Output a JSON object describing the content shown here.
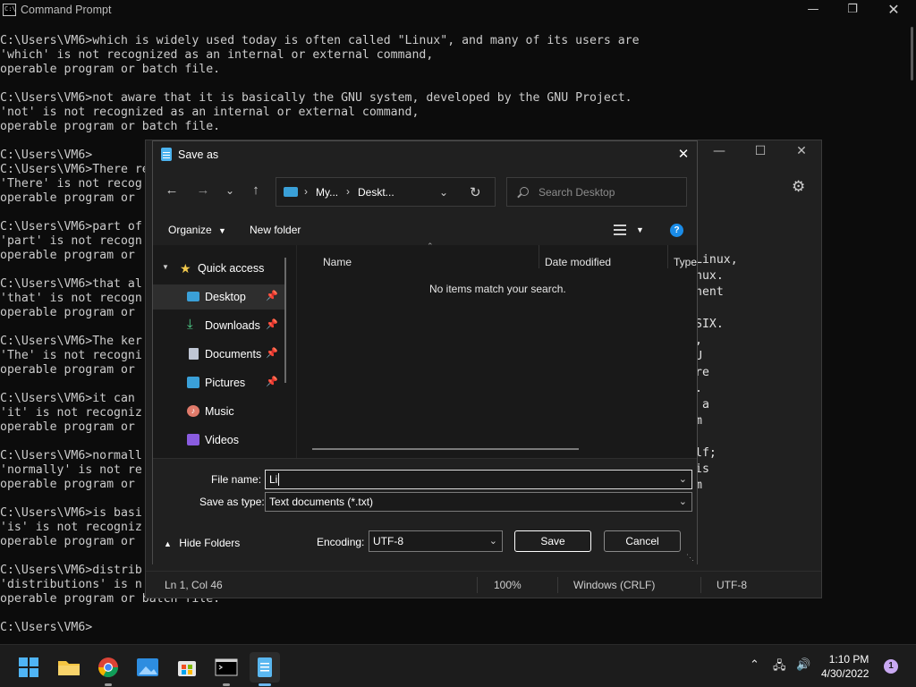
{
  "cmd": {
    "title": "Command Prompt",
    "lines": "C:\\Users\\VM6>which is widely used today is often called \"Linux\", and many of its users are\n'which' is not recognized as an internal or external command,\noperable program or batch file.\n\nC:\\Users\\VM6>not aware that it is basically the GNU system, developed by the GNU Project.\n'not' is not recognized as an internal or external command,\noperable program or batch file.\n\nC:\\Users\\VM6>\nC:\\Users\\VM6>There re\n'There' is not recog\noperable program or \n\nC:\\Users\\VM6>part of\n'part' is not recogn\noperable program or \n\nC:\\Users\\VM6>that al\n'that' is not recogn\noperable program or \n\nC:\\Users\\VM6>The ker\n'The' is not recogni\noperable program or \n\nC:\\Users\\VM6>it can \n'it' is not recogniz\noperable program or \n\nC:\\Users\\VM6>normall\n'normally' is not re\noperable program or \n\nC:\\Users\\VM6>is basi\n'is' is not recogniz\noperable program or \n\nC:\\Users\\VM6>distrib\n'distributions' is n\noperable program or batch file.\n\nC:\\Users\\VM6>"
  },
  "notepad": {
    "visible_text": "Linux,\nnux.\nnent\n\nSIX.\n,\nU\nre\n.\n a\nm\n\nlf;\nis\nm",
    "status": {
      "position": "Ln 1, Col 46",
      "zoom": "100%",
      "line_ending": "Windows (CRLF)",
      "encoding": "UTF-8"
    }
  },
  "dialog": {
    "title": "Save as",
    "address": {
      "part1": "My...",
      "part2": "Deskt..."
    },
    "search_placeholder": "Search Desktop",
    "toolbar": {
      "organize": "Organize",
      "new_folder": "New folder"
    },
    "nav_items": [
      {
        "label": "Quick access"
      },
      {
        "label": "Desktop"
      },
      {
        "label": "Downloads"
      },
      {
        "label": "Documents"
      },
      {
        "label": "Pictures"
      },
      {
        "label": "Music"
      },
      {
        "label": "Videos"
      }
    ],
    "columns": {
      "name": "Name",
      "date_modified": "Date modified",
      "type": "Type"
    },
    "empty_message": "No items match your search.",
    "file_name_label": "File name:",
    "file_name_value": "Li",
    "save_as_type_label": "Save as type:",
    "save_as_type_value": "Text documents (*.txt)",
    "hide_folders": "Hide Folders",
    "encoding_label": "Encoding:",
    "encoding_value": "UTF-8",
    "save": "Save",
    "cancel": "Cancel"
  },
  "taskbar": {
    "time": "1:10 PM",
    "date": "4/30/2022",
    "notification_count": "1"
  },
  "colors": {
    "accent": "#1a8ce8",
    "background": "#0c0c0c",
    "dialog_bg": "#191919"
  }
}
